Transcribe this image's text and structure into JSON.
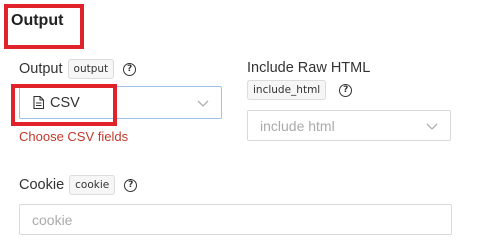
{
  "section": {
    "title": "Output"
  },
  "output_field": {
    "label": "Output",
    "tag": "output",
    "selected": "CSV",
    "error": "Choose CSV fields"
  },
  "raw_html_field": {
    "label": "Include Raw HTML",
    "tag": "include_html",
    "placeholder": "include html"
  },
  "cookie_field": {
    "label": "Cookie",
    "tag": "cookie",
    "placeholder": "cookie"
  },
  "icons": {
    "help": "question-circle-icon",
    "file": "file-icon",
    "chevron": "chevron-down-icon"
  },
  "colors": {
    "highlight": "#e0222a",
    "error": "#c0392b",
    "focus_border": "#9fc3e8"
  }
}
